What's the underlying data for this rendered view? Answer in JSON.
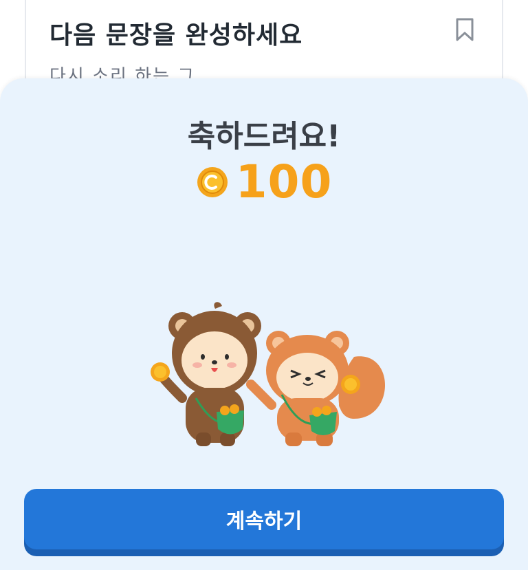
{
  "background_card": {
    "title": "다음 문장을 완성하세요",
    "subtitle_fragment": "다시 소리 하는 그"
  },
  "sheet": {
    "congrats_text": "축하드려요!",
    "reward_amount": "100",
    "continue_label": "계속하기"
  },
  "icons": {
    "bookmark": "bookmark-icon",
    "coin": "coin-icon",
    "mascots": "mascot-squirrels-illustration"
  },
  "colors": {
    "accent": "#2377d9",
    "coin": "#f6a11a",
    "sheet_bg": "#e9f3fd"
  }
}
